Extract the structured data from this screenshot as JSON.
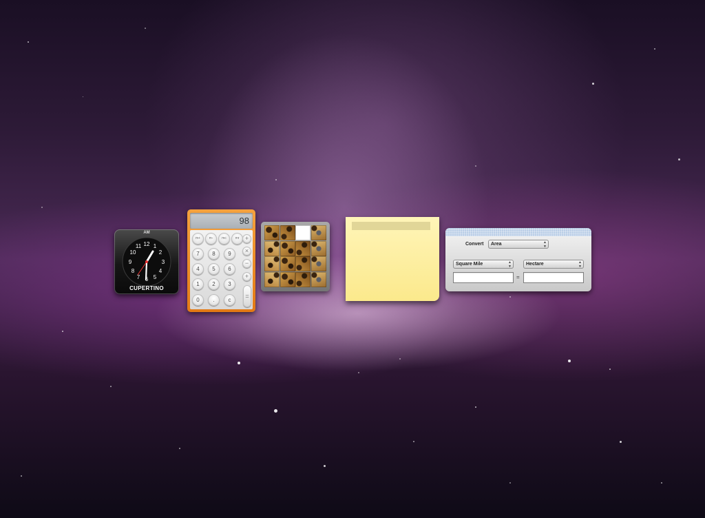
{
  "clock": {
    "ampm": "AM",
    "city": "CUPERTINO",
    "numerals": [
      "12",
      "1",
      "2",
      "3",
      "4",
      "5",
      "6",
      "7",
      "8",
      "9",
      "10",
      "11"
    ]
  },
  "calculator": {
    "display": "98",
    "memory_keys": [
      "m+",
      "m-",
      "mc",
      "mr"
    ],
    "digit_keys": [
      [
        "7",
        "8",
        "9"
      ],
      [
        "4",
        "5",
        "6"
      ],
      [
        "1",
        "2",
        "3"
      ],
      [
        "0",
        ".",
        "c"
      ]
    ],
    "operator_keys": [
      "+",
      "×",
      "−",
      "+"
    ],
    "equals_key": "="
  },
  "tile_game": {
    "tiles": 15,
    "empty_position": "row 1, column 3"
  },
  "stickies": {
    "text": ""
  },
  "unit_converter": {
    "convert_label": "Convert",
    "category": "Area",
    "from_unit": "Square Mile",
    "to_unit": "Hectare",
    "from_value": "",
    "to_value": "",
    "equals_sign": "="
  }
}
